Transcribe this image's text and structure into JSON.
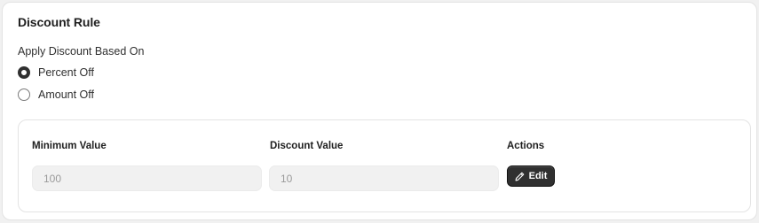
{
  "card": {
    "title": "Discount Rule"
  },
  "discount_basis": {
    "label": "Apply Discount Based On",
    "options": [
      {
        "label": "Percent Off",
        "selected": true
      },
      {
        "label": "Amount Off",
        "selected": false
      }
    ]
  },
  "rules": {
    "headers": {
      "minimum": "Minimum Value",
      "discount": "Discount Value",
      "actions": "Actions"
    },
    "row": {
      "minimum_value": "100",
      "discount_value": "10",
      "edit_label": "Edit",
      "edit_icon": "pencil-icon"
    }
  },
  "colors": {
    "button_bg": "#303030",
    "field_bg": "#f1f1f1",
    "page_bg": "#f1f1f1"
  }
}
